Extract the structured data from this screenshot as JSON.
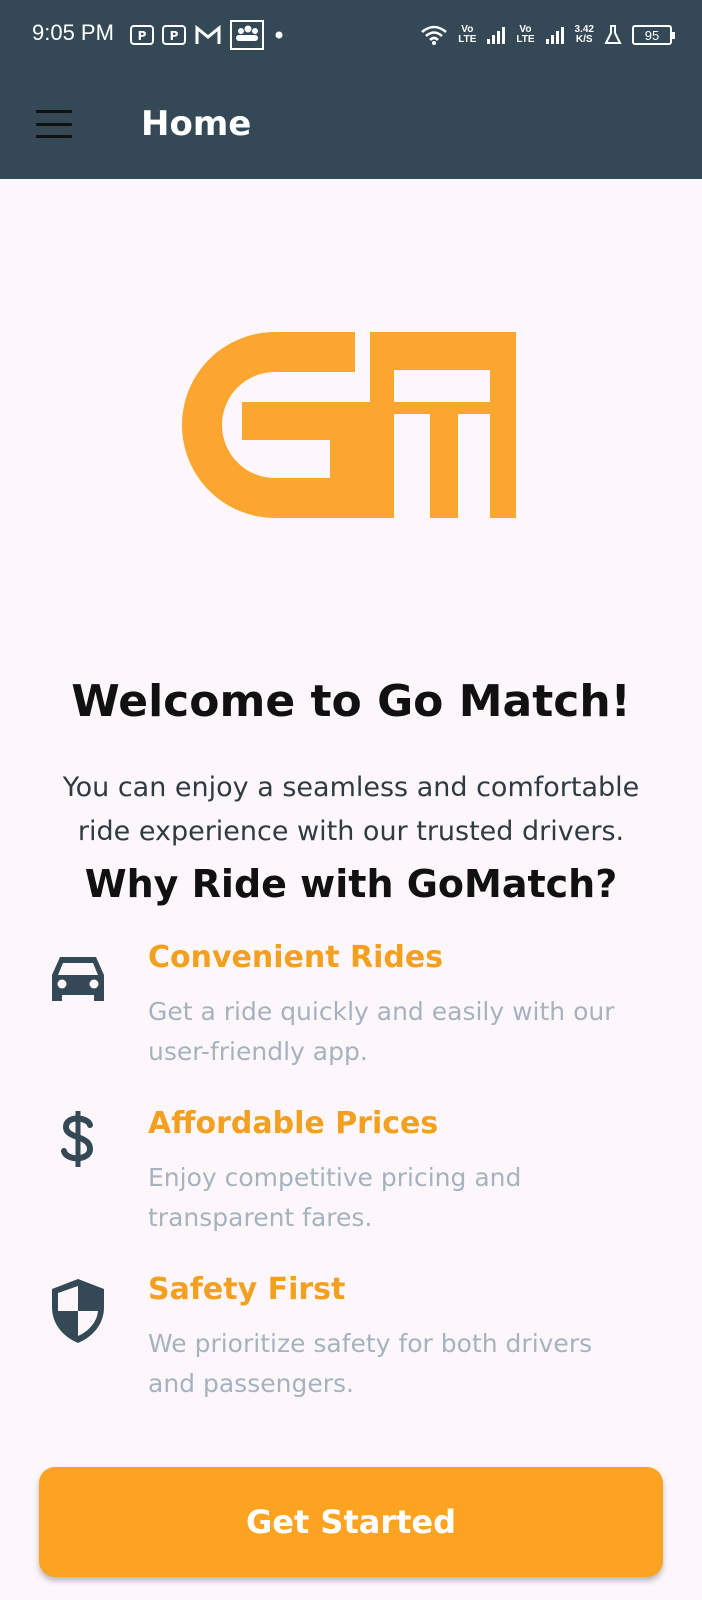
{
  "status_bar": {
    "time": "9:05 PM",
    "net_tag_1_top": "Vo",
    "net_tag_1_bottom": "LTE",
    "net_tag_2_top": "Vo",
    "net_tag_2_bottom": "LTE",
    "speed_value": "3.42",
    "speed_unit": "K/S",
    "battery": "95",
    "icons": [
      "paytm-icon",
      "paytm-icon",
      "gmail-icon",
      "group-icon",
      "dot-icon",
      "wifi-icon",
      "signal-icon",
      "signal-icon",
      "flask-icon",
      "battery-icon"
    ]
  },
  "app_bar": {
    "title": "Home",
    "menu_icon": "hamburger-icon",
    "background": "#344955"
  },
  "logo": {
    "name": "gomatch-logo",
    "color": "#fba630"
  },
  "main": {
    "welcome": "Welcome to Go Match!",
    "subtitle_line1": "You can enjoy a seamless and comfortable",
    "subtitle_line2": "ride experience with our trusted drivers.",
    "why_heading": "Why Ride with GoMatch?"
  },
  "features": [
    {
      "icon": "car-icon",
      "title": "Convenient Rides",
      "desc_line1": "Get a ride quickly and easily with our",
      "desc_line2": "user-friendly app."
    },
    {
      "icon": "dollar-icon",
      "title": "Affordable Prices",
      "desc_line1": "Enjoy competitive pricing and",
      "desc_line2": "transparent fares."
    },
    {
      "icon": "shield-icon",
      "title": "Safety First",
      "desc_line1": "We prioritize safety for both drivers",
      "desc_line2": "and passengers."
    }
  ],
  "cta": {
    "label": "Get Started",
    "color": "#fca321"
  },
  "colors": {
    "accent": "#f3a020",
    "muted": "#a4b3bf",
    "icon": "#344955"
  }
}
